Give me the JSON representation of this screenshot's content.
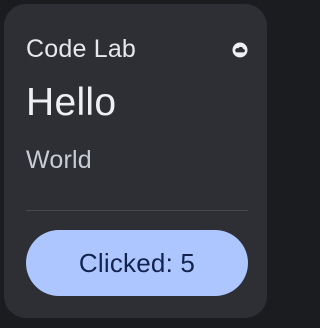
{
  "app": {
    "title": "Code Lab",
    "icon": "cloud-circle-icon"
  },
  "content": {
    "headline": "Hello",
    "subtitle": "World"
  },
  "action": {
    "button_label": "Clicked: 5"
  },
  "colors": {
    "card_background": "#2d2f34",
    "text_primary": "#eef0f5",
    "text_secondary": "#c8ccd4",
    "button_background": "#adc6ff",
    "button_text": "#12244d"
  }
}
